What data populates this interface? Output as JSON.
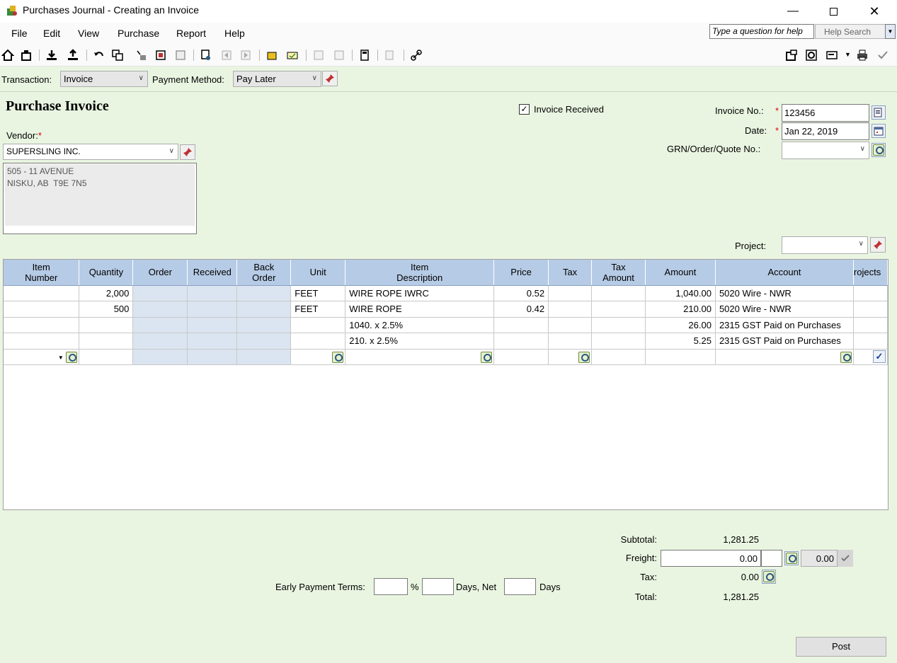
{
  "window": {
    "title": "Purchases Journal - Creating an Invoice",
    "minimize_icon": "minimize-icon",
    "maximize_icon": "maximize-icon",
    "close_icon": "close-icon"
  },
  "menu": {
    "items": [
      "File",
      "Edit",
      "View",
      "Purchase",
      "Report",
      "Help"
    ],
    "help_question_placeholder": "Type a question for help",
    "help_search_label": "Help Search"
  },
  "transaction": {
    "transaction_label": "Transaction:",
    "transaction_value": "Invoice",
    "payment_method_label": "Payment Method:",
    "payment_method_value": "Pay Later"
  },
  "form": {
    "heading": "Purchase Invoice",
    "vendor_label": "Vendor:",
    "vendor_value": "SUPERSLING INC.",
    "address_line1": "505 - 11 AVENUE",
    "address_line2": "NISKU, AB  T9E 7N5",
    "invoice_received_label": "Invoice Received",
    "invoice_received_checked": true,
    "invoice_no_label": "Invoice No.:",
    "invoice_no_value": "123456",
    "date_label": "Date:",
    "date_value": "Jan 22, 2019",
    "grn_label": "GRN/Order/Quote No.:",
    "grn_value": "",
    "project_label": "Project:",
    "project_value": ""
  },
  "grid": {
    "columns": [
      "Item\nNumber",
      "Quantity",
      "Order",
      "Received",
      "Back\nOrder",
      "Unit",
      "Item\nDescription",
      "Price",
      "Tax",
      "Tax\nAmount",
      "Amount",
      "Account",
      "rojects"
    ],
    "rows": [
      {
        "item": "",
        "quantity": "2,000",
        "order": "",
        "received": "",
        "back_order": "",
        "unit": "FEET",
        "description": "WIRE ROPE IWRC",
        "price": "0.52",
        "tax": "",
        "tax_amount": "",
        "amount": "1,040.00",
        "account": "5020 Wire  - NWR",
        "projects": ""
      },
      {
        "item": "",
        "quantity": "500",
        "order": "",
        "received": "",
        "back_order": "",
        "unit": "FEET",
        "description": "WIRE ROPE",
        "price": "0.42",
        "tax": "",
        "tax_amount": "",
        "amount": "210.00",
        "account": "5020 Wire  - NWR",
        "projects": ""
      },
      {
        "item": "",
        "quantity": "",
        "order": "",
        "received": "",
        "back_order": "",
        "unit": "",
        "description": "1040. x 2.5%",
        "price": "",
        "tax": "",
        "tax_amount": "",
        "amount": "26.00",
        "account": "2315 GST Paid on Purchases",
        "projects": ""
      },
      {
        "item": "",
        "quantity": "",
        "order": "",
        "received": "",
        "back_order": "",
        "unit": "",
        "description": "210. x 2.5%",
        "price": "",
        "tax": "",
        "tax_amount": "",
        "amount": "5.25",
        "account": "2315 GST Paid on Purchases",
        "projects": ""
      }
    ]
  },
  "totals": {
    "subtotal_label": "Subtotal:",
    "subtotal_value": "1,281.25",
    "freight_label": "Freight:",
    "freight_value": "0.00",
    "freight_tax_value": "0.00",
    "tax_label": "Tax:",
    "tax_value": "0.00",
    "total_label": "Total:",
    "total_value": "1,281.25"
  },
  "terms": {
    "early_payment_label": "Early Payment Terms:",
    "percent_label": "%",
    "days_net_label": "Days, Net",
    "days_label": "Days"
  },
  "actions": {
    "post_label": "Post"
  },
  "colors": {
    "form_background": "#e9f5e1",
    "grid_header": "#b6cbe5",
    "required_marker": "#dd0000"
  }
}
